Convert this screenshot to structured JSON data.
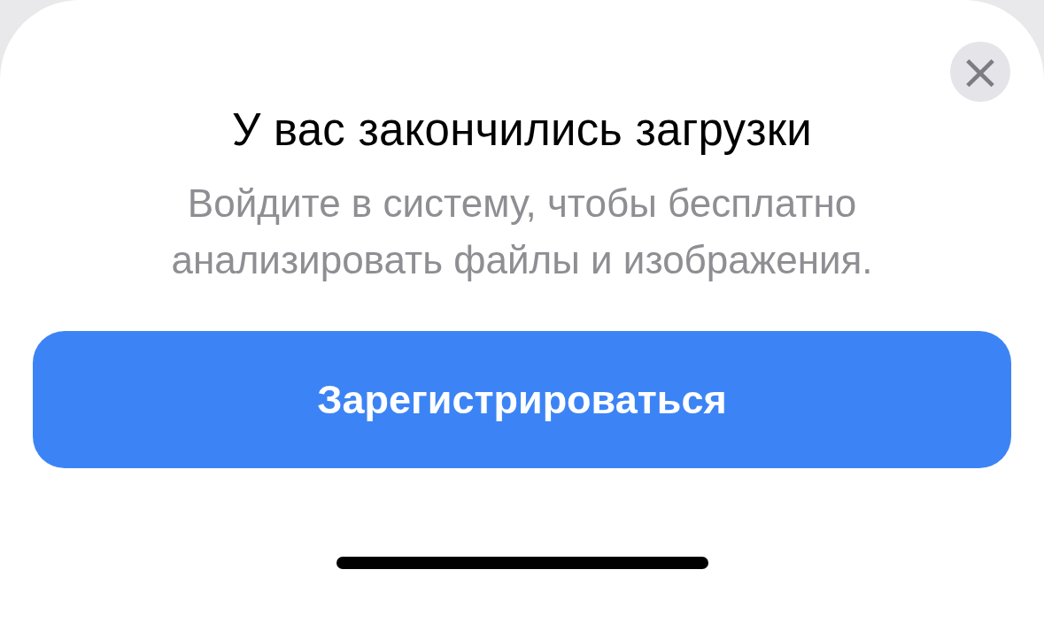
{
  "dialog": {
    "close_label": "×",
    "title": "У вас закончились загрузки",
    "message": "Войдите в систему, чтобы бесплатно анализировать файлы и изображения.",
    "primary_button": "Зарегистрироваться"
  }
}
